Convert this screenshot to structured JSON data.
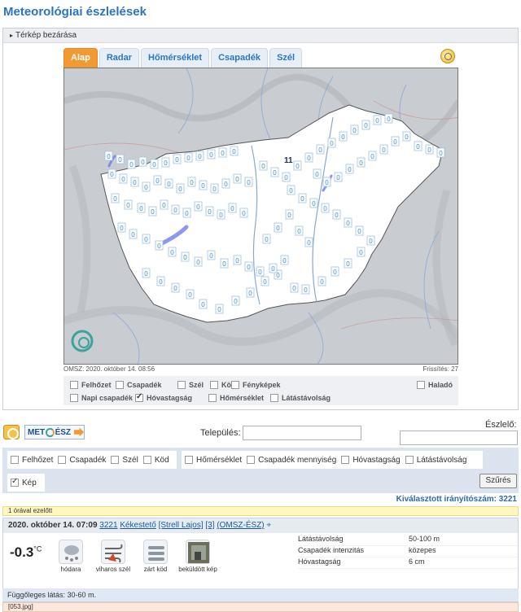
{
  "page_title": "Meteorológiai észlelések",
  "panel": {
    "toggle_label": "Térkép bezárása"
  },
  "tabs": [
    "Alap",
    "Radar",
    "Hőmérséklet",
    "Csapadék",
    "Szél"
  ],
  "active_tab": "Alap",
  "map": {
    "source_time": "OMSZ: 2020. október 14. 08:56",
    "refresh": "Frissítés: 27",
    "value_label": "0",
    "highlight_value": "11",
    "layers": [
      {
        "label": "Felhőzet",
        "checked": false
      },
      {
        "label": "Csapadék",
        "checked": false
      },
      {
        "label": "Szél",
        "checked": false
      },
      {
        "label": "Köd",
        "checked": false
      },
      {
        "label": "Fényképek",
        "checked": false
      },
      {
        "label": "Haladó",
        "checked": false
      },
      {
        "label": "Napi csapadék",
        "checked": false
      },
      {
        "label": "Hóvastagság",
        "checked": true
      },
      {
        "label": "Hőmérséklet",
        "checked": false
      },
      {
        "label": "Látástávolság",
        "checked": false
      }
    ]
  },
  "search": {
    "logo_text": "MET",
    "logo_text2": "ÉSZ",
    "settlement_label": "Település:",
    "observer_label": "Észlelő:"
  },
  "filters": {
    "group1": [
      "Felhőzet",
      "Csapadék",
      "Szél",
      "Köd"
    ],
    "group2": [
      "Hőmérséklet",
      "Csapadék mennyiség",
      "Hóvastagság",
      "Látástávolság"
    ],
    "group3": [
      "Kép"
    ],
    "group3_checked": true,
    "button": "Szűrés"
  },
  "stats": "Kiválasztott irányítószám: 3221",
  "time_bar": "1 órával ezelőtt",
  "observation": {
    "datetime": "2020. október 14. 07:09",
    "zip": "3221",
    "place": "Kékestető",
    "observer": "[Strell Lajos]",
    "count": "[3]",
    "source": "(OMSZ-ÉSZ)",
    "temp": "-0.3",
    "unit": "°C",
    "icons": [
      {
        "name": "hódara",
        "icon": "snow-pellets-icon"
      },
      {
        "name": "viharos szél",
        "icon": "stormy-wind-icon"
      },
      {
        "name": "zárt köd",
        "icon": "fog-icon"
      },
      {
        "name": "beküldött kép",
        "icon": "photo-icon"
      }
    ],
    "details": [
      {
        "k": "Látástávolság",
        "v": "50-100 m"
      },
      {
        "k": "Csapadék intenzitás",
        "v": "közepes"
      },
      {
        "k": "Hóvastagság",
        "v": "6 cm"
      }
    ],
    "vertical_visibility": "Függőleges látás: 30-60 m.",
    "image_file": "[053.jpg]"
  },
  "colors": {
    "accent": "#2a74c3",
    "tab_active": "#f29a32",
    "marker": "#3a8fd6"
  }
}
